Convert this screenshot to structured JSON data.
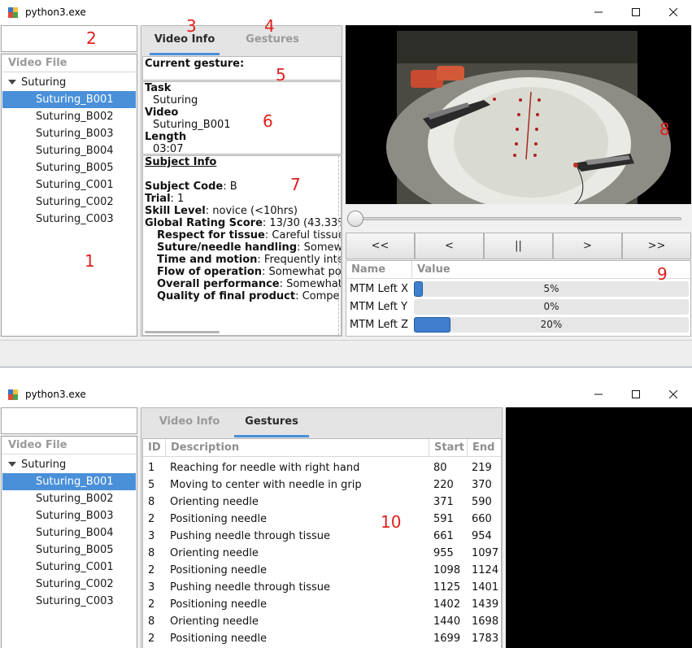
{
  "window1": {
    "title": "python3.exe",
    "file_panel": {
      "header": "Video File",
      "search_value": "",
      "parent": "Suturing",
      "items": [
        "Suturing_B001",
        "Suturing_B002",
        "Suturing_B003",
        "Suturing_B004",
        "Suturing_B005",
        "Suturing_C001",
        "Suturing_C002",
        "Suturing_C003"
      ],
      "selected_index": 0
    },
    "tabs": {
      "video_info": "Video Info",
      "gestures": "Gestures",
      "active": "video_info"
    },
    "current_gesture_label": "Current gesture:",
    "info": {
      "task_label": "Task",
      "task_value": "Suturing",
      "video_label": "Video",
      "video_value": "Suturing_B001",
      "length_label": "Length",
      "length_value": "03:07"
    },
    "subject": {
      "title": "Subject Info",
      "code_label": "Subject Code",
      "code_value": ": B",
      "trial_label": "Trial",
      "trial_value": ": 1",
      "skill_label": "Skill Level",
      "skill_value": ": novice (<10hrs)",
      "grs_label": "Global Rating Score",
      "grs_value": ": 13/30 (43.33%",
      "ratings": [
        {
          "label": "Respect for tissue",
          "value": ": Careful tissue"
        },
        {
          "label": "Suture/needle handling",
          "value": ": Somew"
        },
        {
          "label": "Time and motion",
          "value": ": Frequently inte"
        },
        {
          "label": "Flow of operation",
          "value": ": Somewhat po"
        },
        {
          "label": "Overall performance",
          "value": ": Somewhat"
        },
        {
          "label": "Quality of final product",
          "value": ": Compe"
        }
      ]
    },
    "playback": {
      "position_fraction": 0.0,
      "buttons": [
        "<<",
        "<",
        "||",
        ">",
        ">>"
      ]
    },
    "kinematics": {
      "col_name": "Name",
      "col_value": "Value",
      "rows": [
        {
          "name": "MTM Left X",
          "percent": 5,
          "label": "5%"
        },
        {
          "name": "MTM Left Y",
          "percent": 0,
          "label": "0%"
        },
        {
          "name": "MTM Left Z",
          "percent": 20,
          "label": "20%"
        }
      ]
    },
    "annotations": [
      "1",
      "2",
      "3",
      "4",
      "5",
      "6",
      "7",
      "8",
      "9"
    ]
  },
  "window2": {
    "title": "python3.exe",
    "file_panel": {
      "header": "Video File",
      "search_value": "",
      "parent": "Suturing",
      "items": [
        "Suturing_B001",
        "Suturing_B002",
        "Suturing_B003",
        "Suturing_B004",
        "Suturing_B005",
        "Suturing_C001",
        "Suturing_C002",
        "Suturing_C003"
      ],
      "selected_index": 0
    },
    "tabs": {
      "video_info": "Video Info",
      "gestures": "Gestures",
      "active": "gestures"
    },
    "gestures": {
      "columns": [
        "ID",
        "Description",
        "Start",
        "End"
      ],
      "rows": [
        [
          "1",
          "Reaching for needle with right hand",
          "80",
          "219"
        ],
        [
          "5",
          "Moving to center with needle in grip",
          "220",
          "370"
        ],
        [
          "8",
          "Orienting needle",
          "371",
          "590"
        ],
        [
          "2",
          "Positioning needle",
          "591",
          "660"
        ],
        [
          "3",
          "Pushing needle through tissue",
          "661",
          "954"
        ],
        [
          "8",
          "Orienting needle",
          "955",
          "1097"
        ],
        [
          "2",
          "Positioning needle",
          "1098",
          "1124"
        ],
        [
          "3",
          "Pushing needle through tissue",
          "1125",
          "1401"
        ],
        [
          "2",
          "Positioning needle",
          "1402",
          "1439"
        ],
        [
          "8",
          "Orienting needle",
          "1440",
          "1698"
        ],
        [
          "2",
          "Positioning needle",
          "1699",
          "1783"
        ]
      ]
    },
    "annotation": "10"
  }
}
